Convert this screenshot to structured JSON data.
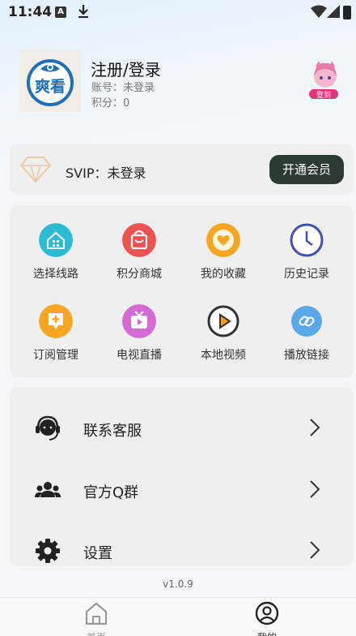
{
  "status_bar": {
    "time": "11:44",
    "notification_letter": "A"
  },
  "profile": {
    "avatar_text": "爽看",
    "name": "注册/登录",
    "account": "账号：未登录",
    "points": "积分：0",
    "checkin_label": "登到"
  },
  "svip": {
    "status": "SVIP：未登录",
    "button_label": "开通会员"
  },
  "grid": {
    "items": [
      {
        "label": "选择线路",
        "icon": "home-network-icon",
        "color": "#2bbcd4"
      },
      {
        "label": "积分商城",
        "icon": "shopping-bag-icon",
        "color": "#ef5350"
      },
      {
        "label": "我的收藏",
        "icon": "heart-icon",
        "color": "#f5a623"
      },
      {
        "label": "历史记录",
        "icon": "clock-icon",
        "color": "#3f51b5"
      },
      {
        "label": "订阅管理",
        "icon": "subscription-icon",
        "color": "#f6a623"
      },
      {
        "label": "电视直播",
        "icon": "tv-icon",
        "color": "#d46bd4"
      },
      {
        "label": "本地视频",
        "icon": "play-circle-icon",
        "color": "#333333"
      },
      {
        "label": "播放链接",
        "icon": "link-icon",
        "color": "#5aa9e6"
      }
    ]
  },
  "menu": {
    "items": [
      {
        "label": "联系客服",
        "icon": "customer-service-icon"
      },
      {
        "label": "官方Q群",
        "icon": "group-icon"
      },
      {
        "label": "设置",
        "icon": "gear-icon"
      }
    ]
  },
  "version": "v1.0.9",
  "tabbar": {
    "tabs": [
      {
        "label": "首页"
      },
      {
        "label": "我的"
      }
    ]
  }
}
